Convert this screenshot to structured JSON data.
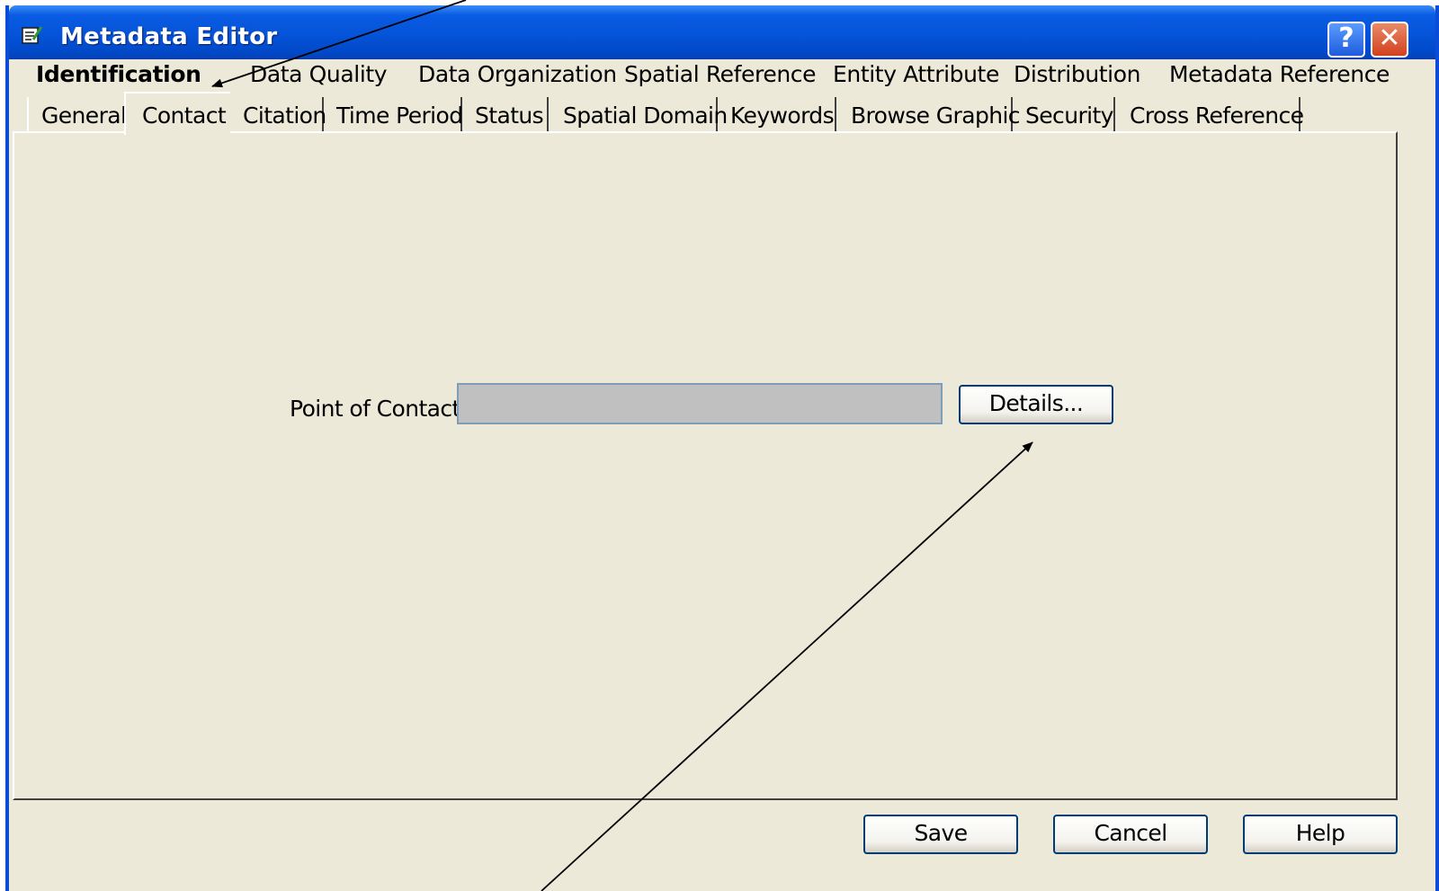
{
  "window": {
    "title": "Metadata Editor"
  },
  "titlebar_buttons": {
    "help_glyph": "?",
    "close_glyph": "✕"
  },
  "main_tabs": [
    {
      "label": "Identification",
      "active": true
    },
    {
      "label": "Data Quality"
    },
    {
      "label": "Data Organization"
    },
    {
      "label": "Spatial Reference"
    },
    {
      "label": "Entity Attribute"
    },
    {
      "label": "Distribution"
    },
    {
      "label": "Metadata Reference"
    }
  ],
  "sub_tabs": [
    {
      "label": "General"
    },
    {
      "label": "Contact",
      "active": true
    },
    {
      "label": "Citation"
    },
    {
      "label": "Time Period"
    },
    {
      "label": "Status"
    },
    {
      "label": "Spatial Domain"
    },
    {
      "label": "Keywords"
    },
    {
      "label": "Browse Graphic"
    },
    {
      "label": "Security"
    },
    {
      "label": "Cross Reference"
    }
  ],
  "contact_panel": {
    "point_of_contact_label": "Point of Contact:",
    "point_of_contact_value": "",
    "details_button": "Details..."
  },
  "footer_buttons": {
    "save": "Save",
    "cancel": "Cancel",
    "help": "Help"
  },
  "colors": {
    "titlebar": "#0553d8",
    "window_border": "#0a4bd8",
    "dialog_background": "#ece9d8",
    "input_background": "#c0c0c0",
    "button_border": "#003c74"
  },
  "icons": {
    "app": "metadata-editor-icon",
    "help": "question-mark-icon",
    "close": "close-icon"
  },
  "annotations": [
    "arrow pointing to Identification tab row",
    "arrow pointing to Details button"
  ]
}
